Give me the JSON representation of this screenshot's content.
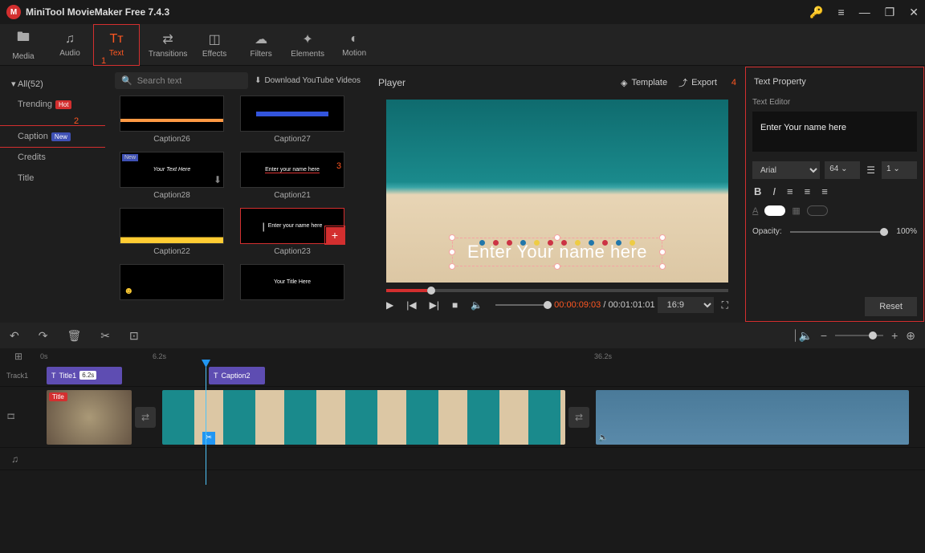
{
  "app": {
    "title": "MiniTool MovieMaker Free 7.4.3"
  },
  "toolbar": {
    "media": "Media",
    "audio": "Audio",
    "text": "Text",
    "transitions": "Transitions",
    "effects": "Effects",
    "filters": "Filters",
    "elements": "Elements",
    "motion": "Motion"
  },
  "annotations": {
    "n1": "1",
    "n2": "2",
    "n3": "3",
    "n4": "4"
  },
  "sidebar": {
    "all": "All(52)",
    "items": [
      {
        "label": "Trending",
        "badge": "Hot"
      },
      {
        "label": "Caption",
        "badge": "New"
      },
      {
        "label": "Credits",
        "badge": ""
      },
      {
        "label": "Title",
        "badge": ""
      }
    ]
  },
  "thumbs": {
    "search_placeholder": "Search text",
    "download_label": "Download YouTube Videos",
    "items": [
      {
        "label": "Caption26",
        "sample": ""
      },
      {
        "label": "Caption27",
        "sample": ""
      },
      {
        "label": "Caption28",
        "sample": "Your Text Here"
      },
      {
        "label": "Caption21",
        "sample": "Enter your name here"
      },
      {
        "label": "Caption22",
        "sample": ""
      },
      {
        "label": "Caption23",
        "sample": "Enter your name here"
      },
      {
        "label": "",
        "sample": ""
      },
      {
        "label": "",
        "sample": "Your Title Here"
      }
    ]
  },
  "player": {
    "title": "Player",
    "template": "Template",
    "export": "Export",
    "overlay_text": "Enter Your name here",
    "current_time": "00:00:09:03",
    "total_time": "00:01:01:01",
    "aspect": "16:9"
  },
  "props": {
    "title": "Text Property",
    "editor_label": "Text Editor",
    "text_value": "Enter Your name here",
    "font": "Arial",
    "size": "64",
    "line": "1",
    "opacity_label": "Opacity:",
    "opacity_value": "100%",
    "reset": "Reset"
  },
  "timeline": {
    "ruler": {
      "t0": "0s",
      "t1": "6.2s",
      "t2": "36.2s"
    },
    "track1_label": "Track1",
    "title_clip": {
      "label": "Title1",
      "dur": "6.2s"
    },
    "caption_clip": {
      "label": "Caption2"
    }
  }
}
